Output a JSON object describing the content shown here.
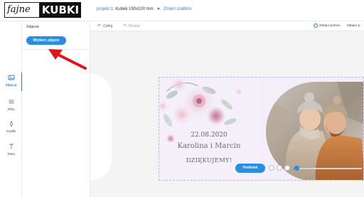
{
  "app": {
    "logo_part1": "fajne",
    "logo_part2": "KUBKI"
  },
  "header": {
    "project_prefix": "projekt 1:",
    "project_name": "Kubek 190x100 mm",
    "change_template": "Zmień szablon"
  },
  "rail": {
    "items": [
      {
        "label": "Zdjęcia",
        "icon": "image-icon",
        "active": true
      },
      {
        "label": "Filtry",
        "icon": "filter-icon",
        "active": false
      },
      {
        "label": "Grafiki",
        "icon": "graphics-icon",
        "active": false
      },
      {
        "label": "Tekst",
        "icon": "text-icon",
        "active": false
      }
    ]
  },
  "panel": {
    "title": "Zdjęcia",
    "choose_button": "Wybierz zdjęcie"
  },
  "toolbar": {
    "undo_label": "Cofnij",
    "redo_label": "Ponów",
    "help_label": "Zobacz pomoc",
    "help_label2": "Zobacz p"
  },
  "print": {
    "date": "22.08.2020",
    "names": "Karolina i Marcin",
    "thanks": "DZIĘKUJEMY!"
  },
  "controls": {
    "replace_button": "Podmień",
    "zoom_level": 0.05
  },
  "colors": {
    "accent": "#2a8de0",
    "arrow": "#e0141b",
    "print_bg": "#f3eef9"
  }
}
